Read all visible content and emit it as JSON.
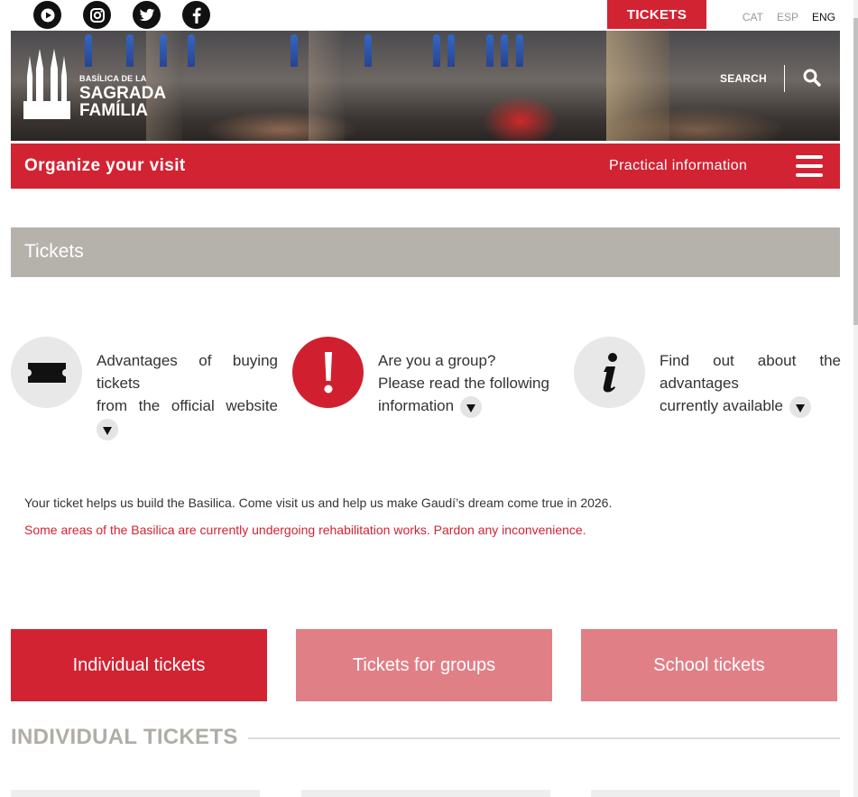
{
  "topbar": {
    "social": [
      {
        "icon": "youtube-icon"
      },
      {
        "icon": "instagram-icon"
      },
      {
        "icon": "twitter-icon"
      },
      {
        "icon": "facebook-icon"
      }
    ],
    "tickets_label": "TICKETS",
    "languages": [
      "CAT",
      "ESP",
      "ENG"
    ],
    "active_language": "ENG"
  },
  "hero": {
    "logo_line1": "BASÍLICA DE LA",
    "logo_line2": "SAGRADA",
    "logo_line3": "FAMÍLIA",
    "search_label": "SEARCH"
  },
  "nav": {
    "title": "Organize your visit",
    "practical_info": "Practical information"
  },
  "section": {
    "title": "Tickets"
  },
  "features": [
    {
      "icon": "ticket-icon",
      "line1": "Advantages of buying",
      "line2": "tickets",
      "line3": "from the official website"
    },
    {
      "icon": "exclamation-icon",
      "line1": "Are you a group?",
      "line2": "Please read the following",
      "line3": "information"
    },
    {
      "icon": "info-icon",
      "line1": "Find out about the",
      "line2": "advantages",
      "line3": "currently available"
    }
  ],
  "messages": {
    "info": "Your ticket helps us build the Basilica. Come visit us and help us make Gaudí’s dream come true in 2026.",
    "warning": "Some areas of the Basilica are currently undergoing rehabilitation works. Pardon any inconvenience."
  },
  "ticket_tabs": [
    {
      "label": "Individual tickets",
      "active": true
    },
    {
      "label": "Tickets for groups",
      "active": false
    },
    {
      "label": "School tickets",
      "active": false
    }
  ],
  "individual_heading": "INDIVIDUAL TICKETS",
  "colors": {
    "brand_red": "#d22333",
    "tab_inactive": "#e17f87",
    "section_grey": "#b5b2ac"
  }
}
